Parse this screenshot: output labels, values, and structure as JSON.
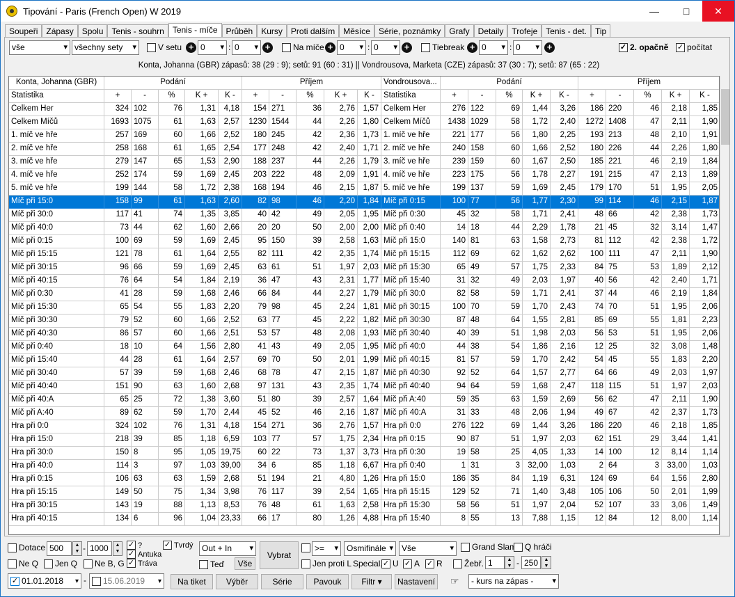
{
  "window": {
    "title": "Tipování - Paris (French Open) W 2019"
  },
  "tabs": [
    "Soupeři",
    "Zápasy",
    "Spolu",
    "Tenis - souhrn",
    "Tenis - míče",
    "Průběh",
    "Kursy",
    "Proti dalším",
    "Měsíce",
    "Série, poznámky",
    "Grafy",
    "Detaily",
    "Trofeje",
    "Tenis - det.",
    "Tip"
  ],
  "active_tab": "Tenis - míče",
  "filters": {
    "sel1": "vše",
    "sel2": "všechny sety",
    "v_setu": "V setu",
    "v_setu_a": "0",
    "v_setu_b": "0",
    "na_mice": "Na míče",
    "na_mice_a": "0",
    "na_mice_b": "0",
    "tiebreak": "Tiebreak",
    "tb_a": "0",
    "tb_b": "0",
    "opacne": "2. opačně",
    "pocitat": "počítat"
  },
  "info_line": "Konta, Johanna (GBR)  zápasů: 38 (29 : 9);  setů: 91 (60 : 31)     ||     Vondrousova, Marketa (CZE)  zápasů: 37 (30 : 7);  setů: 87 (65 : 22)",
  "header": {
    "p1": "Konta, Johanna (GBR)",
    "p2": "Vondrousova...",
    "podani": "Podání",
    "prijem": "Příjem",
    "statistika": "Statistika",
    "cols": [
      "+",
      "-",
      "%",
      "K +",
      "K -"
    ]
  },
  "selected_row": 7,
  "rows": [
    [
      "Celkem Her",
      "324",
      "102",
      "76",
      "1,31",
      "4,18",
      "154",
      "271",
      "36",
      "2,76",
      "1,57",
      "Celkem Her",
      "276",
      "122",
      "69",
      "1,44",
      "3,26",
      "186",
      "220",
      "46",
      "2,18",
      "1,85"
    ],
    [
      "Celkem Míčů",
      "1693",
      "1075",
      "61",
      "1,63",
      "2,57",
      "1230",
      "1544",
      "44",
      "2,26",
      "1,80",
      "Celkem Míčů",
      "1438",
      "1029",
      "58",
      "1,72",
      "2,40",
      "1272",
      "1408",
      "47",
      "2,11",
      "1,90"
    ],
    [
      "1. míč ve hře",
      "257",
      "169",
      "60",
      "1,66",
      "2,52",
      "180",
      "245",
      "42",
      "2,36",
      "1,73",
      "1. míč ve hře",
      "221",
      "177",
      "56",
      "1,80",
      "2,25",
      "193",
      "213",
      "48",
      "2,10",
      "1,91"
    ],
    [
      "2. míč ve hře",
      "258",
      "168",
      "61",
      "1,65",
      "2,54",
      "177",
      "248",
      "42",
      "2,40",
      "1,71",
      "2. míč ve hře",
      "240",
      "158",
      "60",
      "1,66",
      "2,52",
      "180",
      "226",
      "44",
      "2,26",
      "1,80"
    ],
    [
      "3. míč ve hře",
      "279",
      "147",
      "65",
      "1,53",
      "2,90",
      "188",
      "237",
      "44",
      "2,26",
      "1,79",
      "3. míč ve hře",
      "239",
      "159",
      "60",
      "1,67",
      "2,50",
      "185",
      "221",
      "46",
      "2,19",
      "1,84"
    ],
    [
      "4. míč ve hře",
      "252",
      "174",
      "59",
      "1,69",
      "2,45",
      "203",
      "222",
      "48",
      "2,09",
      "1,91",
      "4. míč ve hře",
      "223",
      "175",
      "56",
      "1,78",
      "2,27",
      "191",
      "215",
      "47",
      "2,13",
      "1,89"
    ],
    [
      "5. míč ve hře",
      "199",
      "144",
      "58",
      "1,72",
      "2,38",
      "168",
      "194",
      "46",
      "2,15",
      "1,87",
      "5. míč ve hře",
      "199",
      "137",
      "59",
      "1,69",
      "2,45",
      "179",
      "170",
      "51",
      "1,95",
      "2,05"
    ],
    [
      "Míč při 15:0",
      "158",
      "99",
      "61",
      "1,63",
      "2,60",
      "82",
      "98",
      "46",
      "2,20",
      "1,84",
      "Míč při 0:15",
      "100",
      "77",
      "56",
      "1,77",
      "2,30",
      "99",
      "114",
      "46",
      "2,15",
      "1,87"
    ],
    [
      "Míč při 30:0",
      "117",
      "41",
      "74",
      "1,35",
      "3,85",
      "40",
      "42",
      "49",
      "2,05",
      "1,95",
      "Míč při 0:30",
      "45",
      "32",
      "58",
      "1,71",
      "2,41",
      "48",
      "66",
      "42",
      "2,38",
      "1,73"
    ],
    [
      "Míč při 40:0",
      "73",
      "44",
      "62",
      "1,60",
      "2,66",
      "20",
      "20",
      "50",
      "2,00",
      "2,00",
      "Míč při 0:40",
      "14",
      "18",
      "44",
      "2,29",
      "1,78",
      "21",
      "45",
      "32",
      "3,14",
      "1,47"
    ],
    [
      "Míč při 0:15",
      "100",
      "69",
      "59",
      "1,69",
      "2,45",
      "95",
      "150",
      "39",
      "2,58",
      "1,63",
      "Míč při 15:0",
      "140",
      "81",
      "63",
      "1,58",
      "2,73",
      "81",
      "112",
      "42",
      "2,38",
      "1,72"
    ],
    [
      "Míč při 15:15",
      "121",
      "78",
      "61",
      "1,64",
      "2,55",
      "82",
      "111",
      "42",
      "2,35",
      "1,74",
      "Míč při 15:15",
      "112",
      "69",
      "62",
      "1,62",
      "2,62",
      "100",
      "111",
      "47",
      "2,11",
      "1,90"
    ],
    [
      "Míč při 30:15",
      "96",
      "66",
      "59",
      "1,69",
      "2,45",
      "63",
      "61",
      "51",
      "1,97",
      "2,03",
      "Míč při 15:30",
      "65",
      "49",
      "57",
      "1,75",
      "2,33",
      "84",
      "75",
      "53",
      "1,89",
      "2,12"
    ],
    [
      "Míč při 40:15",
      "76",
      "64",
      "54",
      "1,84",
      "2,19",
      "36",
      "47",
      "43",
      "2,31",
      "1,77",
      "Míč při 15:40",
      "31",
      "32",
      "49",
      "2,03",
      "1,97",
      "40",
      "56",
      "42",
      "2,40",
      "1,71"
    ],
    [
      "Míč při 0:30",
      "41",
      "28",
      "59",
      "1,68",
      "2,46",
      "66",
      "84",
      "44",
      "2,27",
      "1,79",
      "Míč při 30:0",
      "82",
      "58",
      "59",
      "1,71",
      "2,41",
      "37",
      "44",
      "46",
      "2,19",
      "1,84"
    ],
    [
      "Míč při 15:30",
      "65",
      "54",
      "55",
      "1,83",
      "2,20",
      "79",
      "98",
      "45",
      "2,24",
      "1,81",
      "Míč při 30:15",
      "100",
      "70",
      "59",
      "1,70",
      "2,43",
      "74",
      "70",
      "51",
      "1,95",
      "2,06"
    ],
    [
      "Míč při 30:30",
      "79",
      "52",
      "60",
      "1,66",
      "2,52",
      "63",
      "77",
      "45",
      "2,22",
      "1,82",
      "Míč při 30:30",
      "87",
      "48",
      "64",
      "1,55",
      "2,81",
      "85",
      "69",
      "55",
      "1,81",
      "2,23"
    ],
    [
      "Míč při 40:30",
      "86",
      "57",
      "60",
      "1,66",
      "2,51",
      "53",
      "57",
      "48",
      "2,08",
      "1,93",
      "Míč při 30:40",
      "40",
      "39",
      "51",
      "1,98",
      "2,03",
      "56",
      "53",
      "51",
      "1,95",
      "2,06"
    ],
    [
      "Míč při 0:40",
      "18",
      "10",
      "64",
      "1,56",
      "2,80",
      "41",
      "43",
      "49",
      "2,05",
      "1,95",
      "Míč při 40:0",
      "44",
      "38",
      "54",
      "1,86",
      "2,16",
      "12",
      "25",
      "32",
      "3,08",
      "1,48"
    ],
    [
      "Míč při 15:40",
      "44",
      "28",
      "61",
      "1,64",
      "2,57",
      "69",
      "70",
      "50",
      "2,01",
      "1,99",
      "Míč při 40:15",
      "81",
      "57",
      "59",
      "1,70",
      "2,42",
      "54",
      "45",
      "55",
      "1,83",
      "2,20"
    ],
    [
      "Míč při 30:40",
      "57",
      "39",
      "59",
      "1,68",
      "2,46",
      "68",
      "78",
      "47",
      "2,15",
      "1,87",
      "Míč při 40:30",
      "92",
      "52",
      "64",
      "1,57",
      "2,77",
      "64",
      "66",
      "49",
      "2,03",
      "1,97"
    ],
    [
      "Míč při 40:40",
      "151",
      "90",
      "63",
      "1,60",
      "2,68",
      "97",
      "131",
      "43",
      "2,35",
      "1,74",
      "Míč při 40:40",
      "94",
      "64",
      "59",
      "1,68",
      "2,47",
      "118",
      "115",
      "51",
      "1,97",
      "2,03"
    ],
    [
      "Míč při 40:A",
      "65",
      "25",
      "72",
      "1,38",
      "3,60",
      "51",
      "80",
      "39",
      "2,57",
      "1,64",
      "Míč při A:40",
      "59",
      "35",
      "63",
      "1,59",
      "2,69",
      "56",
      "62",
      "47",
      "2,11",
      "1,90"
    ],
    [
      "Míč při A:40",
      "89",
      "62",
      "59",
      "1,70",
      "2,44",
      "45",
      "52",
      "46",
      "2,16",
      "1,87",
      "Míč při 40:A",
      "31",
      "33",
      "48",
      "2,06",
      "1,94",
      "49",
      "67",
      "42",
      "2,37",
      "1,73"
    ],
    [
      "Hra při 0:0",
      "324",
      "102",
      "76",
      "1,31",
      "4,18",
      "154",
      "271",
      "36",
      "2,76",
      "1,57",
      "Hra při 0:0",
      "276",
      "122",
      "69",
      "1,44",
      "3,26",
      "186",
      "220",
      "46",
      "2,18",
      "1,85"
    ],
    [
      "Hra při 15:0",
      "218",
      "39",
      "85",
      "1,18",
      "6,59",
      "103",
      "77",
      "57",
      "1,75",
      "2,34",
      "Hra při 0:15",
      "90",
      "87",
      "51",
      "1,97",
      "2,03",
      "62",
      "151",
      "29",
      "3,44",
      "1,41"
    ],
    [
      "Hra při 30:0",
      "150",
      "8",
      "95",
      "1,05",
      "19,75",
      "60",
      "22",
      "73",
      "1,37",
      "3,73",
      "Hra při 0:30",
      "19",
      "58",
      "25",
      "4,05",
      "1,33",
      "14",
      "100",
      "12",
      "8,14",
      "1,14"
    ],
    [
      "Hra při 40:0",
      "114",
      "3",
      "97",
      "1,03",
      "39,00",
      "34",
      "6",
      "85",
      "1,18",
      "6,67",
      "Hra při 0:40",
      "1",
      "31",
      "3",
      "32,00",
      "1,03",
      "2",
      "64",
      "3",
      "33,00",
      "1,03"
    ],
    [
      "Hra při 0:15",
      "106",
      "63",
      "63",
      "1,59",
      "2,68",
      "51",
      "194",
      "21",
      "4,80",
      "1,26",
      "Hra při 15:0",
      "186",
      "35",
      "84",
      "1,19",
      "6,31",
      "124",
      "69",
      "64",
      "1,56",
      "2,80"
    ],
    [
      "Hra při 15:15",
      "149",
      "50",
      "75",
      "1,34",
      "3,98",
      "76",
      "117",
      "39",
      "2,54",
      "1,65",
      "Hra při 15:15",
      "129",
      "52",
      "71",
      "1,40",
      "3,48",
      "105",
      "106",
      "50",
      "2,01",
      "1,99"
    ],
    [
      "Hra při 30:15",
      "143",
      "19",
      "88",
      "1,13",
      "8,53",
      "76",
      "48",
      "61",
      "1,63",
      "2,58",
      "Hra při 15:30",
      "58",
      "56",
      "51",
      "1,97",
      "2,04",
      "52",
      "107",
      "33",
      "3,06",
      "1,49"
    ],
    [
      "Hra při 40:15",
      "134",
      "6",
      "96",
      "1,04",
      "23,33",
      "66",
      "17",
      "80",
      "1,26",
      "4,88",
      "Hra při 15:40",
      "8",
      "55",
      "13",
      "7,88",
      "1,15",
      "12",
      "84",
      "12",
      "8,00",
      "1,14"
    ]
  ],
  "bottom": {
    "dotace": "Dotace",
    "v500": "500",
    "v1000": "1000",
    "q": "?",
    "antuka": "Antuka",
    "trava": "Tráva",
    "tvrdy": "Tvrdý",
    "ted": "Teď",
    "out_in": "Out + In",
    "vse_btn": "Vše",
    "vybrat": "Vybrat",
    "gte": ">=",
    "osmifinale": "Osmifinále",
    "vse2": "Vše",
    "grand_slam": "Grand Slam",
    "q_hraci": "Q hráči",
    "ne_q": "Ne Q",
    "jen_q": "Jen Q",
    "ne_b_g": "Ne B, G",
    "jen_proti_l": "Jen proti L",
    "special": "Special.",
    "u": "U",
    "a": "A",
    "r": "R",
    "zebr": "Žebř.",
    "zebr_a": "1",
    "zebr_b": "250",
    "date_from": "01.01.2018",
    "date_to": "15.06.2019",
    "na_tiket": "Na tiket",
    "vyber": "Výběr",
    "serie": "Série",
    "pavouk": "Pavouk",
    "filtr": "Filtr ▾",
    "nastaveni": "Nastavení",
    "kurs": "- kurs na zápas -"
  }
}
